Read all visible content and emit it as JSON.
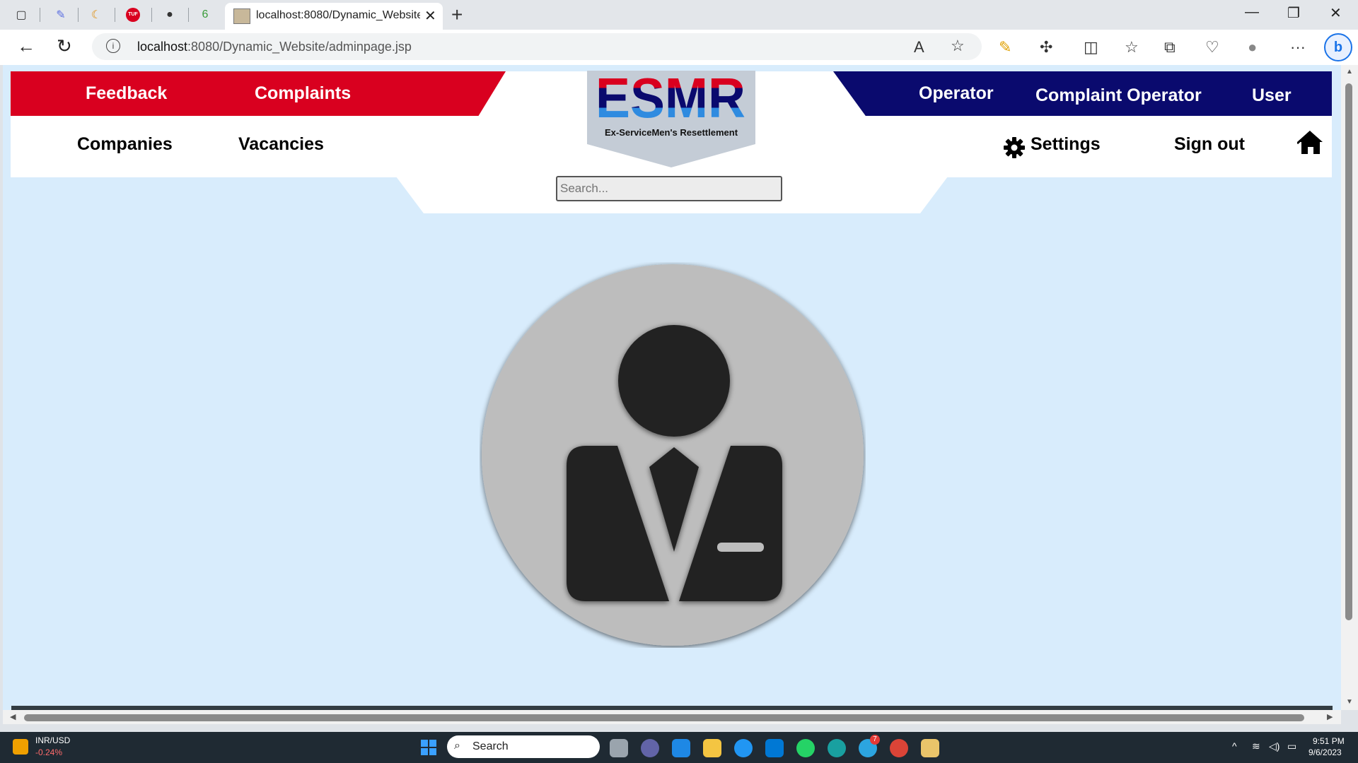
{
  "browser": {
    "active_tab_title": "localhost:8080/Dynamic_Website",
    "url_host": "localhost",
    "url_rest": ":8080/Dynamic_Website/adminpage.jsp"
  },
  "site": {
    "logo_text": "ESMR",
    "logo_subtitle": "Ex-ServiceMen's Resettlement",
    "nav_red": [
      "Feedback",
      "Complaints"
    ],
    "nav_blue": [
      "Operator",
      "Complaint Operator",
      "User"
    ],
    "nav_left": [
      "Companies",
      "Vacancies"
    ],
    "settings_label": "Settings",
    "signout_label": "Sign out",
    "search_placeholder": "Search..."
  },
  "taskbar": {
    "ticker_name": "INR/USD",
    "ticker_change": "-0.24%",
    "search_label": "Search",
    "time": "9:51 PM",
    "date": "9/6/2023",
    "telegram_badge": "7"
  },
  "colors": {
    "red_band": "#d9001f",
    "blue_band": "#0a0a6e",
    "page_bg": "#d8ecfc"
  }
}
